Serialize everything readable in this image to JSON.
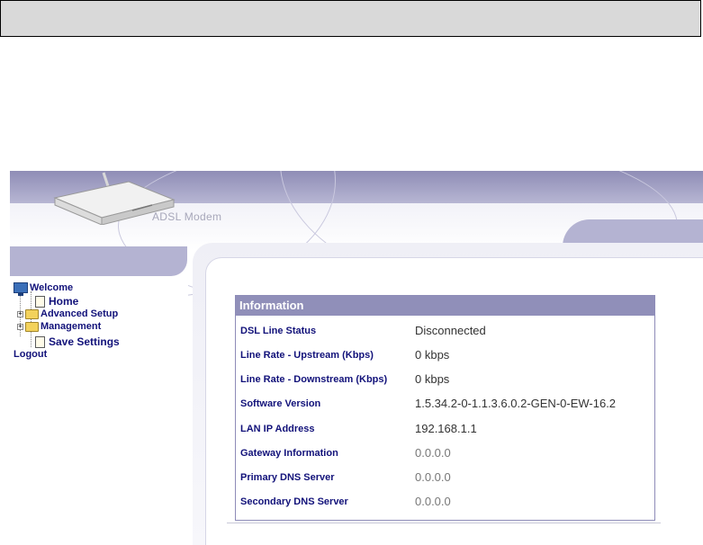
{
  "modem_title": "ADSL Modem",
  "nav": {
    "welcome": "Welcome",
    "home": "Home",
    "advanced_setup": "Advanced Setup",
    "management": "Management",
    "save_settings": "Save Settings",
    "logout": "Logout"
  },
  "info": {
    "title": "Information",
    "rows": [
      {
        "label": "DSL Line Status",
        "value": "Disconnected"
      },
      {
        "label": "Line Rate - Upstream (Kbps)",
        "value": "0 kbps"
      },
      {
        "label": "Line Rate - Downstream (Kbps)",
        "value": "0 kbps"
      },
      {
        "label": "Software Version",
        "value": "1.5.34.2-0-1.1.3.6.0.2-GEN-0-EW-16.2"
      },
      {
        "label": "LAN IP Address",
        "value": "192.168.1.1"
      },
      {
        "label": "Gateway Information",
        "value": "0.0.0.0"
      },
      {
        "label": "Primary DNS Server",
        "value": "0.0.0.0"
      },
      {
        "label": "Secondary DNS Server",
        "value": "0.0.0.0"
      }
    ]
  },
  "icons": {
    "welcome": "monitor-icon",
    "home": "page-icon",
    "advanced_setup": "folder-icon",
    "management": "folder-icon",
    "save_settings": "page-icon",
    "expand": "plus-box-icon"
  },
  "colors": {
    "banner": "#908fb9",
    "nav_text": "#12127a",
    "toolbar": "#d9d9d9"
  }
}
